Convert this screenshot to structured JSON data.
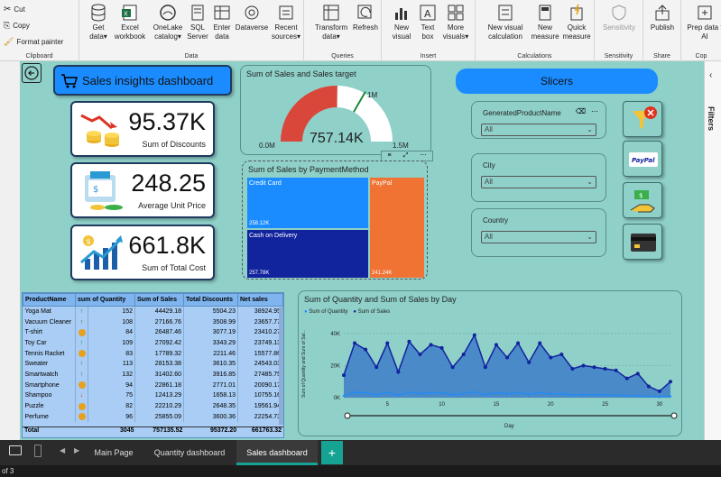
{
  "ribbon": {
    "clipboard": {
      "cut": "Cut",
      "copy": "Copy",
      "format_painter": "Format painter",
      "label": "Clipboard"
    },
    "data_group": {
      "label": "Data",
      "buttons": [
        {
          "line1": "Get",
          "line2": "data"
        },
        {
          "line1": "Excel",
          "line2": "workbook"
        },
        {
          "line1": "OneLake",
          "line2": "catalog"
        },
        {
          "line1": "SQL",
          "line2": "Server"
        },
        {
          "line1": "Enter",
          "line2": "data"
        },
        {
          "line1": "Dataverse",
          "line2": ""
        },
        {
          "line1": "Recent",
          "line2": "sources"
        }
      ]
    },
    "queries": {
      "label": "Queries",
      "transform": "Transform",
      "transform2": "data",
      "refresh": "Refresh"
    },
    "insert": {
      "label": "Insert",
      "new_visual": "New",
      "new_visual2": "visual",
      "text_box": "Text",
      "text_box2": "box",
      "more_visuals": "More",
      "more_visuals2": "visuals"
    },
    "calculations": {
      "label": "Calculations",
      "new_visual_calc": "New visual",
      "new_visual_calc2": "calculation",
      "new_measure": "New",
      "new_measure2": "measure",
      "quick_measure": "Quick",
      "quick_measure2": "measure"
    },
    "sensitivity": {
      "label": "Sensitivity",
      "btn": "Sensitivity"
    },
    "share": {
      "label": "Share",
      "publish": "Publish"
    },
    "copilot": {
      "label": "Cop",
      "prep": "Prep data f",
      "prep2": "AI"
    }
  },
  "dashboard": {
    "title": "Sales insights dashboard",
    "slicers_title": "Slicers",
    "kpis": [
      {
        "value": "95.37K",
        "caption": "Sum of Discounts"
      },
      {
        "value": "248.25",
        "caption": "Average Unit Price"
      },
      {
        "value": "661.8K",
        "caption": "Sum of Total Cost"
      }
    ],
    "gauge": {
      "title": "Sum of Sales and Sales target",
      "value": "757.14K",
      "min": "0.0M",
      "max": "1.5M",
      "target": "1M",
      "fraction": 0.505
    },
    "treemap": {
      "title": "Sum of Sales by PaymentMethod",
      "items": [
        {
          "label": "Credit Card",
          "value": "258.12K",
          "color": "#1a8cff"
        },
        {
          "label": "PayPal",
          "value": "241.24K",
          "color": "#f07333"
        },
        {
          "label": "Cash on Delivery",
          "value": "257.78K",
          "color": "#12239e"
        }
      ]
    },
    "slicers": [
      {
        "title": "GeneratedProductName",
        "value": "All"
      },
      {
        "title": "City",
        "value": "All"
      },
      {
        "title": "Country",
        "value": "All"
      }
    ],
    "table": {
      "headers": [
        "ProductName",
        "sum of Quantity",
        "Sum of Sales",
        "Total Discounts",
        "Net sales"
      ],
      "rows": [
        [
          "Yoga Mat",
          "up",
          "152",
          "44429.18",
          "5504.23",
          "38924.95"
        ],
        [
          "Vacuum Cleaner",
          "up",
          "108",
          "27166.76",
          "3508.99",
          "23657.77"
        ],
        [
          "T-shirt",
          "mid",
          "84",
          "26487.46",
          "3077.19",
          "23410.27"
        ],
        [
          "Toy Car",
          "up",
          "109",
          "27092.42",
          "3343.29",
          "23749.13"
        ],
        [
          "Tennis Racket",
          "mid",
          "83",
          "17789.32",
          "2211.46",
          "15577.86"
        ],
        [
          "Sweater",
          "up",
          "113",
          "28153.38",
          "3610.35",
          "24543.03"
        ],
        [
          "Smartwatch",
          "up",
          "132",
          "31402.60",
          "3916.85",
          "27485.75"
        ],
        [
          "Smartphone",
          "mid",
          "94",
          "22861.18",
          "2771.01",
          "20090.17"
        ],
        [
          "Shampoo",
          "down",
          "75",
          "12413.29",
          "1658.13",
          "10755.16"
        ],
        [
          "Puzzle",
          "mid",
          "82",
          "22210.29",
          "2648.35",
          "19561.94"
        ],
        [
          "Perfume",
          "mid",
          "96",
          "25855.09",
          "3600.36",
          "22254.73"
        ]
      ],
      "total": [
        "Total",
        "3045",
        "757135.52",
        "95372.20",
        "661763.32"
      ]
    },
    "line_chart": {
      "title": "Sum of Quantity and Sum of Sales by Day",
      "legend": [
        "Sum of Quantity",
        "Sum of Sales"
      ],
      "ylabel": "Sum of Quantity and Sum of Sal...",
      "xlabel": "Day",
      "yticks": [
        "40K",
        "20K",
        "0K"
      ],
      "xticks": [
        "5",
        "10",
        "15",
        "20",
        "25",
        "30"
      ]
    }
  },
  "chart_data": {
    "type": "area",
    "title": "Sum of Quantity and Sum of Sales by Day",
    "xlabel": "Day",
    "ylabel": "Sum of Quantity and Sum of Sal...",
    "ylim": [
      0,
      45000
    ],
    "xlim": [
      1,
      31
    ],
    "x": [
      1,
      2,
      3,
      4,
      5,
      6,
      7,
      8,
      9,
      10,
      11,
      12,
      13,
      14,
      15,
      16,
      17,
      18,
      19,
      20,
      21,
      22,
      23,
      24,
      25,
      26,
      27,
      28,
      29,
      30,
      31
    ],
    "series": [
      {
        "name": "Sum of Sales",
        "values": [
          14000,
          34000,
          30000,
          19000,
          34000,
          16000,
          35000,
          27000,
          33000,
          31000,
          19000,
          27000,
          39000,
          19000,
          33000,
          25000,
          34000,
          22000,
          34000,
          25000,
          27000,
          18000,
          20000,
          19000,
          18000,
          17000,
          12000,
          15000,
          7000,
          4000,
          10000
        ]
      },
      {
        "name": "Sum of Quantity",
        "values": [
          50,
          150,
          130,
          80,
          140,
          70,
          150,
          110,
          140,
          130,
          80,
          110,
          160,
          80,
          140,
          100,
          140,
          90,
          140,
          100,
          110,
          75,
          85,
          80,
          75,
          70,
          50,
          60,
          30,
          15,
          40
        ]
      }
    ],
    "legend": "top-left"
  },
  "tabs": {
    "pages": [
      "Main Page",
      "Quantity dashboard",
      "Sales dashboard"
    ],
    "active": "Sales dashboard",
    "add": "+"
  },
  "status": {
    "page_info": "of 3"
  },
  "filters_pane": {
    "label": "Filters"
  }
}
